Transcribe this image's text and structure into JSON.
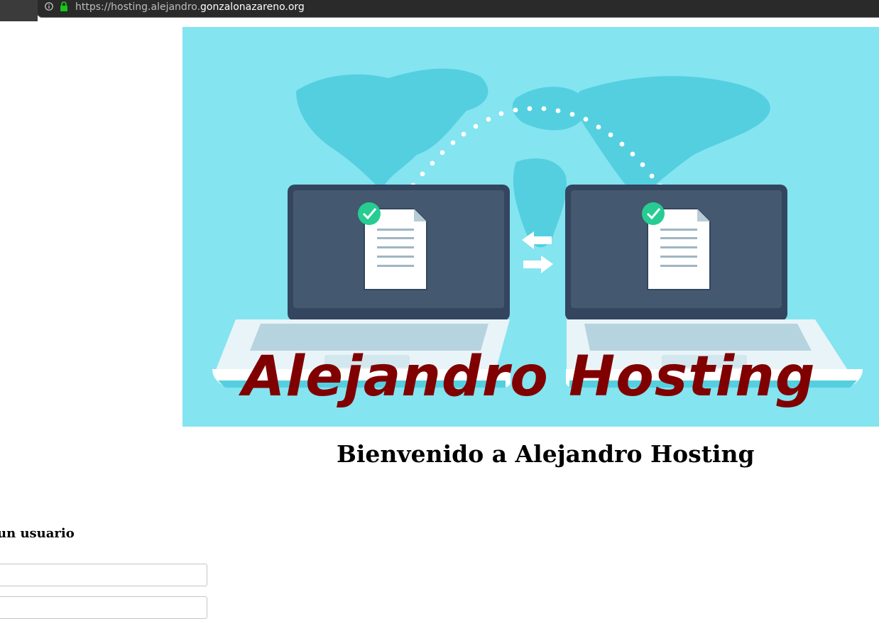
{
  "browser": {
    "url_prefix": "https://hosting.alejandro.",
    "url_domain": "gonzalonazareno.org"
  },
  "banner": {
    "title": "Alejandro Hosting",
    "title_color": "#800000",
    "background_color": "#84e4f0"
  },
  "main": {
    "welcome_heading": "Bienvenido a Alejandro Hosting"
  },
  "login_form": {
    "label": "un usuario",
    "fields": [
      {
        "value": "",
        "placeholder": ""
      },
      {
        "value": "",
        "placeholder": ""
      }
    ]
  }
}
